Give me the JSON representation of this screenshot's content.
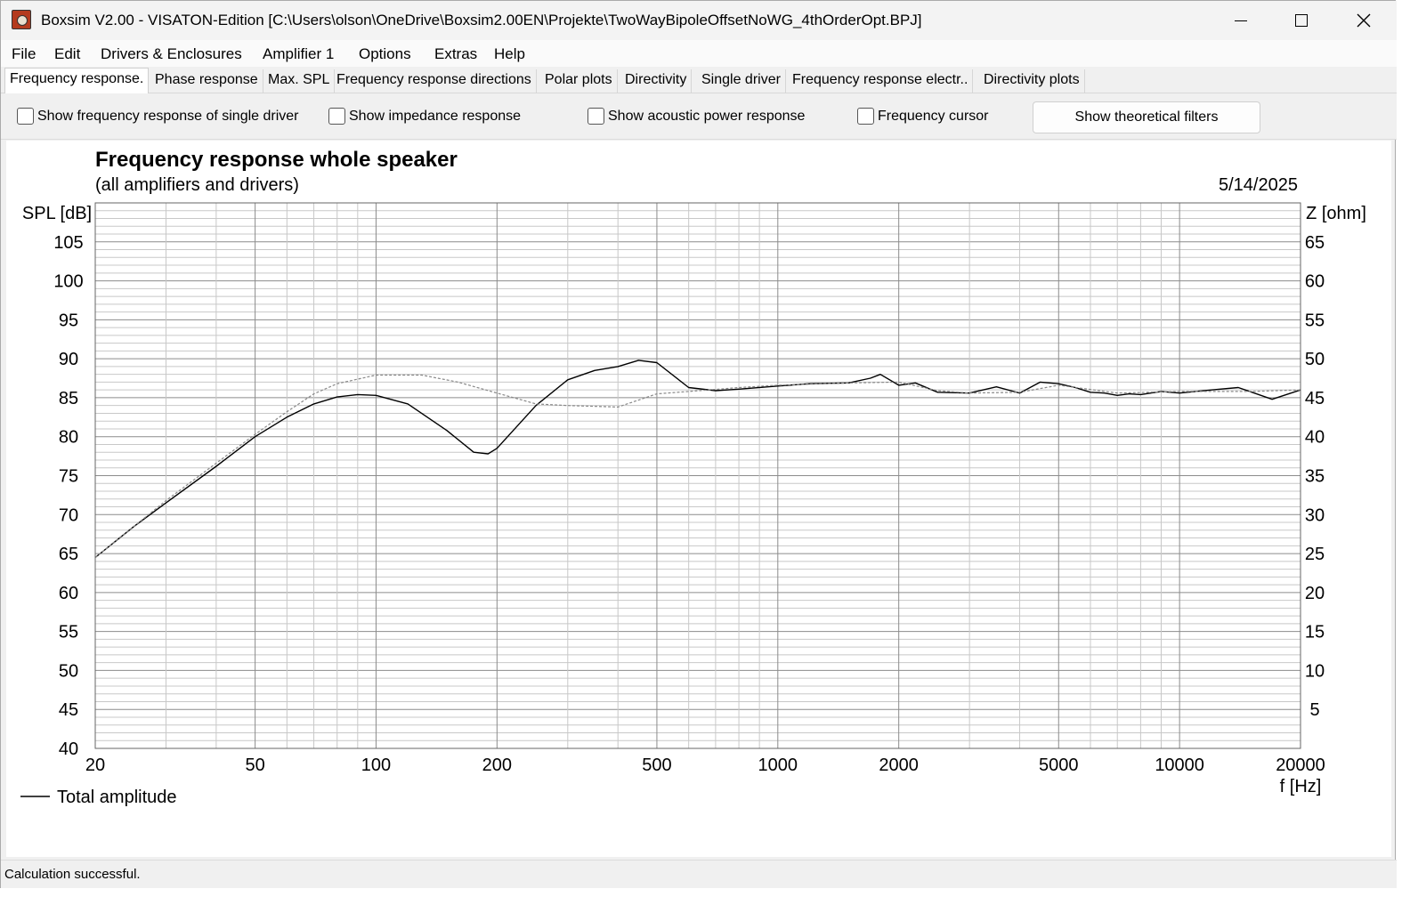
{
  "window": {
    "title": "Boxsim V2.00 - VISATON-Edition [C:\\Users\\olson\\OneDrive\\Boxsim2.00EN\\Projekte\\TwoWayBipoleOffsetNoWG_4thOrderOpt.BPJ]",
    "icon": "boxsim-app-icon"
  },
  "menu": [
    "File",
    "Edit",
    "Drivers & Enclosures",
    "Amplifier 1",
    "Options",
    "Extras",
    "Help"
  ],
  "tabs": [
    {
      "label": "Frequency response.",
      "active": true
    },
    {
      "label": "Phase response",
      "active": false
    },
    {
      "label": "Max. SPL",
      "active": false
    },
    {
      "label": "Frequency response directions",
      "active": false
    },
    {
      "label": "Polar plots",
      "active": false
    },
    {
      "label": "Directivity",
      "active": false
    },
    {
      "label": "Single driver",
      "active": false
    },
    {
      "label": "Frequency response electr..",
      "active": false
    },
    {
      "label": "Directivity plots",
      "active": false
    }
  ],
  "options": {
    "checkboxes": [
      {
        "label": "Show frequency response of single driver",
        "checked": false
      },
      {
        "label": "Show impedance response",
        "checked": false
      },
      {
        "label": "Show acoustic power response",
        "checked": false
      },
      {
        "label": "Frequency cursor",
        "checked": false
      }
    ],
    "button_label": "Show theoretical filters"
  },
  "status": "Calculation successful.",
  "chart_data": {
    "type": "line",
    "title": "Frequency response whole speaker",
    "subtitle": "(all amplifiers and drivers)",
    "date": "5/14/2025",
    "ylabel": "SPL [dB]",
    "y2label": "Z [ohm]",
    "xlabel": "f [Hz]",
    "x_scale": "log",
    "xlim": [
      20,
      20000
    ],
    "ylim": [
      40,
      110
    ],
    "y2lim": [
      0,
      70
    ],
    "x_tick_labels": [
      "20",
      "50",
      "100",
      "200",
      "500",
      "1000",
      "2000",
      "5000",
      "10000",
      "20000"
    ],
    "y_tick_labels": [
      "40",
      "45",
      "50",
      "55",
      "60",
      "65",
      "70",
      "75",
      "80",
      "85",
      "90",
      "95",
      "100",
      "105"
    ],
    "y2_tick_labels": [
      "5",
      "10",
      "15",
      "20",
      "25",
      "30",
      "35",
      "40",
      "45",
      "50",
      "55",
      "60",
      "65"
    ],
    "grid": true,
    "legend": {
      "position": "bottom-left",
      "entries": [
        "Total amplitude"
      ]
    },
    "series": [
      {
        "name": "Total amplitude",
        "style": "solid",
        "color": "#000000",
        "x": [
          20,
          25,
          30,
          40,
          50,
          60,
          70,
          80,
          90,
          100,
          120,
          150,
          175,
          190,
          200,
          250,
          300,
          350,
          400,
          450,
          500,
          600,
          700,
          800,
          1000,
          1200,
          1500,
          1700,
          1800,
          2000,
          2200,
          2500,
          3000,
          3500,
          4000,
          4500,
          5000,
          5500,
          6000,
          6500,
          7000,
          7500,
          8000,
          9000,
          10000,
          12000,
          14000,
          17000,
          20000
        ],
        "values": [
          64.5,
          68.5,
          71.5,
          76.2,
          80.0,
          82.5,
          84.2,
          85.1,
          85.4,
          85.3,
          84.2,
          80.8,
          78.0,
          77.8,
          78.5,
          84.0,
          87.3,
          88.5,
          89.0,
          89.8,
          89.5,
          86.3,
          85.9,
          86.1,
          86.5,
          86.8,
          86.9,
          87.5,
          88.0,
          86.6,
          86.9,
          85.7,
          85.6,
          86.4,
          85.6,
          87.0,
          86.8,
          86.3,
          85.7,
          85.6,
          85.3,
          85.5,
          85.4,
          85.8,
          85.6,
          86.0,
          86.3,
          84.8,
          86.0
        ]
      },
      {
        "name": "",
        "style": "dashed",
        "color": "#888888",
        "x": [
          20,
          30,
          40,
          50,
          60,
          70,
          80,
          100,
          130,
          160,
          200,
          250,
          300,
          400,
          500,
          600,
          800,
          1000,
          1500,
          2000,
          2500,
          3000,
          4000,
          5000,
          7000,
          10000,
          15000,
          20000
        ],
        "values": [
          64.5,
          71.8,
          76.6,
          80.3,
          83.2,
          85.5,
          86.8,
          87.9,
          87.9,
          87.0,
          85.6,
          84.2,
          84.0,
          83.8,
          85.5,
          85.8,
          86.3,
          86.6,
          86.9,
          87.0,
          85.9,
          85.6,
          85.7,
          86.6,
          85.6,
          85.8,
          85.8,
          86.0
        ]
      }
    ]
  }
}
